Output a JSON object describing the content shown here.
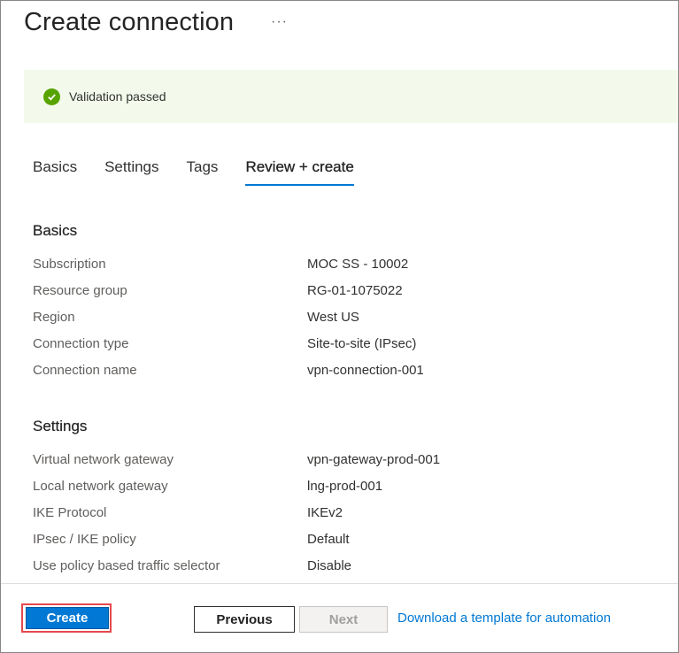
{
  "header": {
    "title": "Create connection",
    "more_label": "···"
  },
  "validation": {
    "message": "Validation passed"
  },
  "tabs": [
    {
      "label": "Basics",
      "active": false
    },
    {
      "label": "Settings",
      "active": false
    },
    {
      "label": "Tags",
      "active": false
    },
    {
      "label": "Review + create",
      "active": true
    }
  ],
  "sections": {
    "basics": {
      "title": "Basics",
      "rows": [
        {
          "label": "Subscription",
          "value": "MOC SS - 10002"
        },
        {
          "label": "Resource group",
          "value": "RG-01-1075022"
        },
        {
          "label": "Region",
          "value": "West US"
        },
        {
          "label": "Connection type",
          "value": "Site-to-site (IPsec)"
        },
        {
          "label": "Connection name",
          "value": "vpn-connection-001"
        }
      ]
    },
    "settings": {
      "title": "Settings",
      "rows": [
        {
          "label": "Virtual network gateway",
          "value": "vpn-gateway-prod-001"
        },
        {
          "label": "Local network gateway",
          "value": "lng-prod-001"
        },
        {
          "label": "IKE Protocol",
          "value": "IKEv2"
        },
        {
          "label": "IPsec / IKE policy",
          "value": "Default"
        },
        {
          "label": "Use policy based traffic selector",
          "value": "Disable"
        }
      ]
    }
  },
  "footer": {
    "create_label": "Create",
    "previous_label": "Previous",
    "next_label": "Next",
    "template_link": "Download a template for automation"
  },
  "colors": {
    "accent": "#0078d4",
    "success": "#57a300",
    "banner_bg": "#f3faeb",
    "highlight": "#e5484d"
  }
}
